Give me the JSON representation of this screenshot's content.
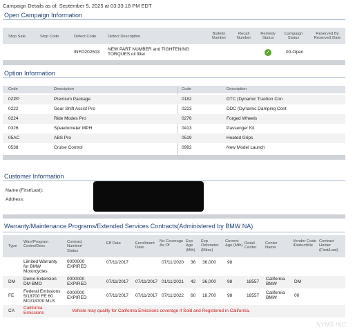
{
  "as_of_text": "Campaign Details as of: September 5, 2025 at 03:33:18 PM EDT",
  "open_campaign": {
    "title": "Open Campaign Information",
    "headers": {
      "stop_sale": "Stop Sale",
      "stop_code": "Stop Code",
      "defect_code": "Defect Code",
      "defect_description": "Defect Description",
      "bulletin_number": "Bulletin Number",
      "recall_number": "Recall Number",
      "remedy_status": "Remedy Status",
      "campaign_status": "Campaign Status",
      "reserved_by": "Reserved By Reserved Date"
    },
    "rows": [
      {
        "defect_code": "INFO202503",
        "defect_description": "NEW PART NUMBER and TIGHTENING TORQUES oil filter",
        "remedy_icon": "check-circle-icon",
        "campaign_status": "00-Open"
      }
    ]
  },
  "options": {
    "title": "Option Information",
    "headers": {
      "code": "Code",
      "description": "Description"
    },
    "left": [
      {
        "code": "0ZPP",
        "description": "Premium Package"
      },
      {
        "code": "0222",
        "description": "Gear Shift Assist Pro"
      },
      {
        "code": "0224",
        "description": "Ride Modes Pro"
      },
      {
        "code": "0326",
        "description": "Speedometer MPH"
      },
      {
        "code": "05AC",
        "description": "ABS Pro"
      },
      {
        "code": "0538",
        "description": "Cruise Control"
      }
    ],
    "right": [
      {
        "code": "0182",
        "description": "DTC (Dynamic Traction Con"
      },
      {
        "code": "0223",
        "description": "DDC (Dynamic Damping Cont"
      },
      {
        "code": "0276",
        "description": "Forged Wheels"
      },
      {
        "code": "0413",
        "description": "Passenger Kit"
      },
      {
        "code": "0519",
        "description": "Heated Grips"
      },
      {
        "code": "0992",
        "description": "New Model Launch"
      }
    ]
  },
  "customer": {
    "title": "Customer Information",
    "name_label": "Name (First/Last):",
    "address_label": "Address:"
  },
  "warranty": {
    "title": "Warranty/Maintenance Programs/Extended Services Contracts(Administered by BMW NA)",
    "headers": {
      "type": "Type",
      "program": "Warr/Program Codes/Desc",
      "contract": "Contract Number/ Status",
      "eff_date": "Eff Date",
      "enroll_date": "Enrollment Date",
      "no_coverage": "No Coverage As Of",
      "exp_age": "Exp Age (Mth)",
      "exp_odometer": "Exp Odometer (Miles)",
      "current_age": "Current Age (Mth)",
      "retail_center": "Retail Center",
      "center_name": "Center Name",
      "vendor_code": "Vendor Code /Deductible",
      "contract_holder": "Contract Holder (First/Last)"
    },
    "rows": [
      {
        "type": "",
        "program": "Limited Warranty for BMW Motorcycles",
        "contract": "0000000 EXPIRED",
        "eff_date": "07/11/2017",
        "enroll_date": "",
        "no_coverage": "07/11/2020",
        "exp_age": "36",
        "exp_odometer": "36,000",
        "current_age": "98",
        "retail_center": "",
        "center_name": "",
        "vendor_code": ""
      },
      {
        "type": "DM",
        "program": "Demo Extension DM BMO",
        "contract": "0000000 EXPIRED",
        "eff_date": "07/11/2017",
        "enroll_date": "07/11/2017",
        "no_coverage": "01/11/2021",
        "exp_age": "42",
        "exp_odometer": "36,000",
        "current_age": "98",
        "retail_center": "18557",
        "center_name": "California BMW",
        "vendor_code": "DM"
      },
      {
        "type": "FE",
        "program": "Federal Emissions 5/18700 FE 60 MO/18700 MLS",
        "contract": "0000000 EXPIRED",
        "eff_date": "07/11/2017",
        "enroll_date": "07/11/2017",
        "no_coverage": "07/11/2022",
        "exp_age": "60",
        "exp_odometer": "18,700",
        "current_age": "98",
        "retail_center": "18557",
        "center_name": "California BMW",
        "vendor_code": "00"
      }
    ],
    "ca_row": {
      "type": "CA",
      "program": "California Emissions",
      "note": "Vehicle may qualify for California Emissions coverage if Sold and Registered in California."
    }
  },
  "watermark": "NYNG INC."
}
